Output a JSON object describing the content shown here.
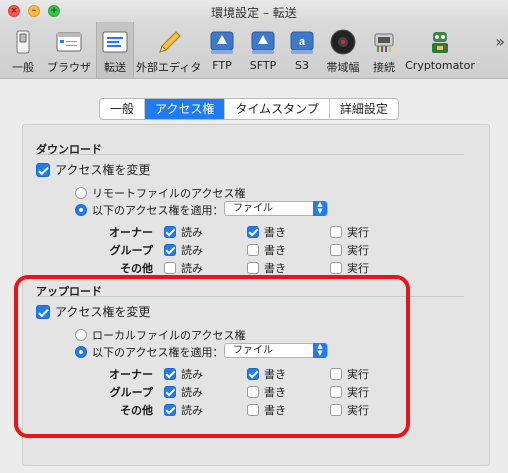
{
  "window": {
    "title": "環境設定 – 転送"
  },
  "toolbar": {
    "items": [
      {
        "label": "一般",
        "icon": "switch-icon"
      },
      {
        "label": "ブラウザ",
        "icon": "browser-window-icon"
      },
      {
        "label": "転送",
        "icon": "transfer-list-icon",
        "selected": true
      },
      {
        "label": "外部エディタ",
        "icon": "pencil-icon"
      },
      {
        "label": "FTP",
        "icon": "ftp-drive-icon"
      },
      {
        "label": "SFTP",
        "icon": "sftp-drive-icon"
      },
      {
        "label": "S3",
        "icon": "s3-drive-icon"
      },
      {
        "label": "帯域幅",
        "icon": "gauge-icon"
      },
      {
        "label": "接続",
        "icon": "network-connector-icon"
      },
      {
        "label": "Cryptomator",
        "icon": "cryptomator-robot-icon"
      }
    ],
    "more": "»"
  },
  "tabs": [
    {
      "label": "一般",
      "active": false
    },
    {
      "label": "アクセス権",
      "active": true
    },
    {
      "label": "タイムスタンプ",
      "active": false
    },
    {
      "label": "詳細設定",
      "active": false
    }
  ],
  "download": {
    "title": "ダウンロード",
    "change": {
      "label": "アクセス権を変更",
      "checked": true
    },
    "radio_remote": {
      "label": "リモートファイルのアクセス権",
      "selected": false
    },
    "radio_apply": {
      "label": "以下のアクセス権を適用：",
      "selected": true
    },
    "select_value": "ファイル",
    "rows": [
      {
        "label": "オーナー",
        "read": {
          "label": "読み",
          "checked": true
        },
        "write": {
          "label": "書き",
          "checked": true
        },
        "exec": {
          "label": "実行",
          "checked": false
        }
      },
      {
        "label": "グループ",
        "read": {
          "label": "読み",
          "checked": true
        },
        "write": {
          "label": "書き",
          "checked": false
        },
        "exec": {
          "label": "実行",
          "checked": false
        }
      },
      {
        "label": "その他",
        "read": {
          "label": "読み",
          "checked": false
        },
        "write": {
          "label": "書き",
          "checked": false
        },
        "exec": {
          "label": "実行",
          "checked": false
        }
      }
    ]
  },
  "upload": {
    "title": "アップロード",
    "change": {
      "label": "アクセス権を変更",
      "checked": true
    },
    "radio_local": {
      "label": "ローカルファイルのアクセス権",
      "selected": false
    },
    "radio_apply": {
      "label": "以下のアクセス権を適用：",
      "selected": true
    },
    "select_value": "ファイル",
    "rows": [
      {
        "label": "オーナー",
        "read": {
          "label": "読み",
          "checked": true
        },
        "write": {
          "label": "書き",
          "checked": true
        },
        "exec": {
          "label": "実行",
          "checked": false
        }
      },
      {
        "label": "グループ",
        "read": {
          "label": "読み",
          "checked": true
        },
        "write": {
          "label": "書き",
          "checked": false
        },
        "exec": {
          "label": "実行",
          "checked": false
        }
      },
      {
        "label": "その他",
        "read": {
          "label": "読み",
          "checked": true
        },
        "write": {
          "label": "書き",
          "checked": false
        },
        "exec": {
          "label": "実行",
          "checked": false
        }
      }
    ]
  },
  "colors": {
    "accent": "#1f7cf5",
    "highlight": "#e8141a"
  }
}
